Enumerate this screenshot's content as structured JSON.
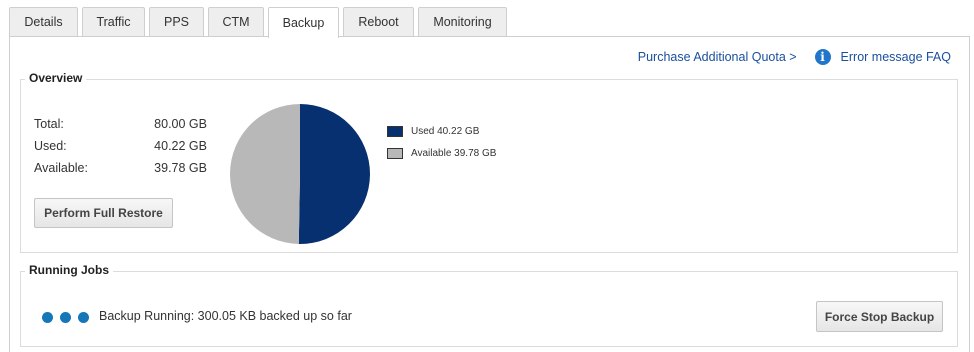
{
  "tabs": [
    {
      "label": "Details",
      "active": false
    },
    {
      "label": "Traffic",
      "active": false
    },
    {
      "label": "PPS",
      "active": false
    },
    {
      "label": "CTM",
      "active": false
    },
    {
      "label": "Backup",
      "active": true
    },
    {
      "label": "Reboot",
      "active": false
    },
    {
      "label": "Monitoring",
      "active": false
    }
  ],
  "links": {
    "purchase": "Purchase Additional Quota >",
    "info_icon": "info-icon",
    "faq": "Error message FAQ"
  },
  "overview": {
    "title": "Overview",
    "stats": [
      {
        "label": "Total:",
        "value": "80.00 GB"
      },
      {
        "label": "Used:",
        "value": "40.22 GB"
      },
      {
        "label": "Available:",
        "value": "39.78 GB"
      }
    ],
    "restore_label": "Perform Full Restore",
    "pie": {
      "slices": [
        {
          "name": "Used",
          "value": 40.22,
          "color": "#06306f",
          "legend": "Used 40.22 GB"
        },
        {
          "name": "Available",
          "value": 39.78,
          "color": "#b8b8b8",
          "legend": "Available 39.78 GB"
        }
      ]
    }
  },
  "running": {
    "title": "Running Jobs",
    "status_text": "Backup Running: 300.05 KB backed up so far",
    "stop_label": "Force Stop Backup",
    "dot_color": "#1576b8"
  }
}
